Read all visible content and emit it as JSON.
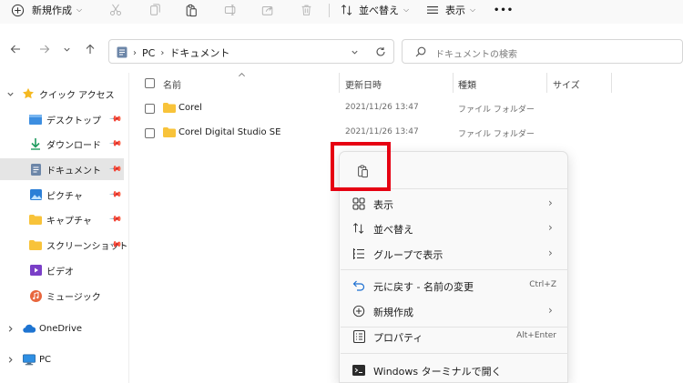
{
  "toolbar": {
    "new_label": "新規作成",
    "sort_label": "並べ替え",
    "view_label": "表示",
    "more_label": "•••"
  },
  "address": {
    "crumbs": [
      "PC",
      "ドキュメント"
    ]
  },
  "search": {
    "placeholder": "ドキュメントの検索"
  },
  "sidebar": {
    "quick_access": "クイック アクセス",
    "items": [
      {
        "label": "デスクトップ",
        "icon": "desktop-icon",
        "pinned": true
      },
      {
        "label": "ダウンロード",
        "icon": "download-icon",
        "pinned": true
      },
      {
        "label": "ドキュメント",
        "icon": "document-icon",
        "pinned": true,
        "selected": true
      },
      {
        "label": "ピクチャ",
        "icon": "picture-icon",
        "pinned": true
      },
      {
        "label": "キャプチャ",
        "icon": "folder-icon",
        "pinned": true
      },
      {
        "label": "スクリーンショット",
        "icon": "folder-icon",
        "pinned": true
      },
      {
        "label": "ビデオ",
        "icon": "video-icon",
        "pinned": false
      },
      {
        "label": "ミュージック",
        "icon": "music-icon",
        "pinned": false
      }
    ],
    "onedrive": "OneDrive",
    "pc": "PC"
  },
  "columns": {
    "name": "名前",
    "modified": "更新日時",
    "type": "種類",
    "size": "サイズ"
  },
  "files": [
    {
      "name": "Corel",
      "modified": "2021/11/26 13:47",
      "type": "ファイル フォルダー"
    },
    {
      "name": "Corel Digital Studio SE",
      "modified": "2021/11/26 13:47",
      "type": "ファイル フォルダー"
    }
  ],
  "context_menu": {
    "items": [
      {
        "label": "表示",
        "icon": "grid-icon",
        "submenu": true
      },
      {
        "label": "並べ替え",
        "icon": "sort-icon",
        "submenu": true
      },
      {
        "label": "グループで表示",
        "icon": "group-icon",
        "submenu": true
      },
      {
        "label": "元に戻す - 名前の変更",
        "icon": "undo-icon",
        "shortcut": "Ctrl+Z"
      },
      {
        "label": "新規作成",
        "icon": "plus-circle-icon",
        "submenu": true
      },
      {
        "label": "プロパティ",
        "icon": "properties-icon",
        "shortcut": "Alt+Enter"
      },
      {
        "label": "Windows ターミナルで開く",
        "icon": "terminal-icon"
      }
    ]
  },
  "colors": {
    "highlight_box": "#e60012",
    "accent": "#0067c0",
    "folder": "#f8c33a"
  }
}
